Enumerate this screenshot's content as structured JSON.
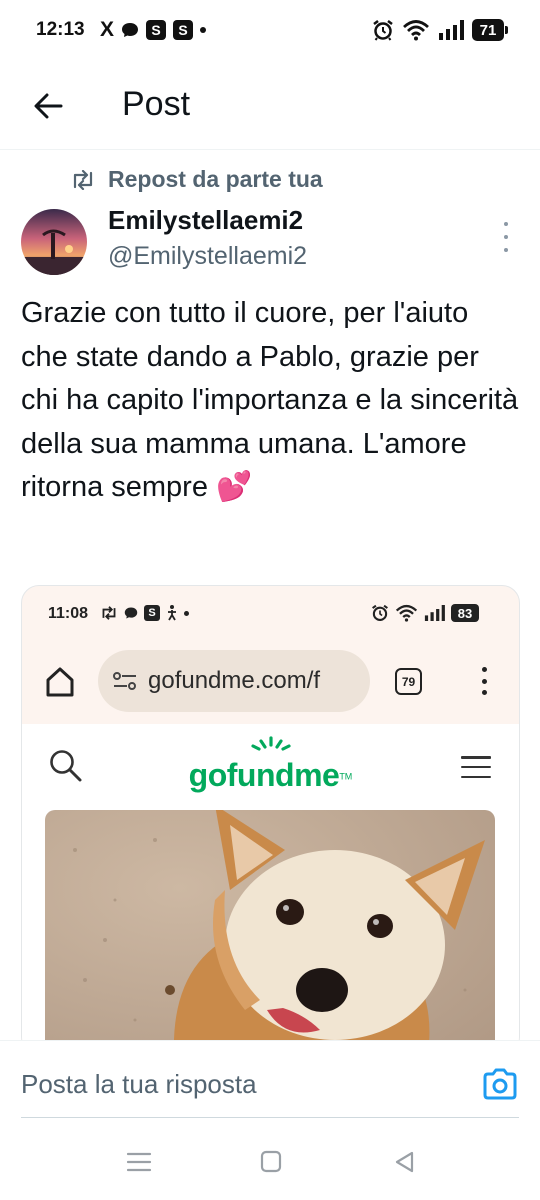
{
  "status_bar": {
    "time": "12:13",
    "x_icon": "X",
    "badge_1": "S",
    "badge_2": "S",
    "battery": "71"
  },
  "header": {
    "title": "Post",
    "back_icon": "arrow-left-icon"
  },
  "post": {
    "repost_label": "Repost da parte tua",
    "author_name": "Emilystellaemi2",
    "author_handle": "@Emilystellaemi2",
    "text": "Grazie con tutto il cuore, per l'aiuto che state dando a Pablo, grazie per chi ha capito l'importanza e la sincerità della sua mamma umana. L'amore ritorna sempre 💕"
  },
  "media": {
    "status_time": "11:08",
    "status_badge": "S",
    "battery": "83",
    "url": "gofundme.com/f",
    "tab_count": "79",
    "logo": "gofundme",
    "logo_tm": "TM",
    "brand_color": "#02a95c"
  },
  "reply": {
    "placeholder": "Posta la tua risposta",
    "camera_icon": "camera-icon",
    "accent_color": "#1d9bf0"
  },
  "nav": {
    "recents_icon": "menu-lines-icon",
    "home_icon": "square-icon",
    "back_icon": "triangle-back-icon"
  }
}
